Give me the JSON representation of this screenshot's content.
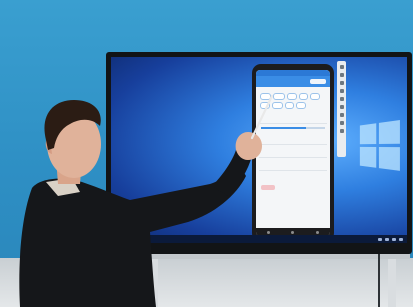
{
  "scene": {
    "wall_color": "#3a9fd0",
    "display_frame_color": "#121416",
    "desktop_color": "#2f7fe0",
    "logo_icon": "windows-logo-icon"
  },
  "phone_app": {
    "accent_color": "#3a8de6",
    "chip_count": 9,
    "slider_level": 0.7,
    "row_count": 4
  },
  "presenter": {
    "jacket_color": "#15171a",
    "shirt_color": "#d9d1c6",
    "skin_color": "#e0b29a",
    "hair_color": "#2b1c14",
    "pointer": "stylus"
  }
}
